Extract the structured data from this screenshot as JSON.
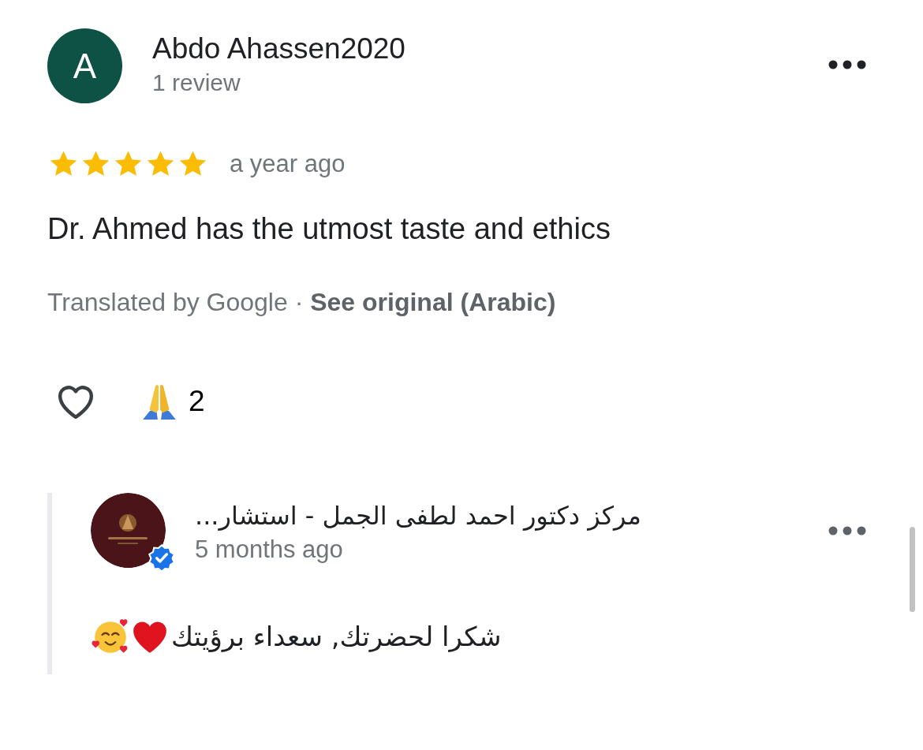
{
  "review": {
    "avatar_letter": "A",
    "author": "Abdo Ahassen2020",
    "author_meta": "1 review",
    "stars": 5,
    "time": "a year ago",
    "text": "Dr. Ahmed has the utmost taste and ethics",
    "translation_note": "Translated by Google · ",
    "see_original": "See original (Arabic)",
    "liked": false,
    "reaction_count": "2"
  },
  "owner_reply": {
    "author": "مركز دكتور احمد لطفى الجمل - استشار...",
    "verified": true,
    "time": "5 months ago",
    "text": "شكرا لحضرتك, سعداء برؤيتك"
  }
}
